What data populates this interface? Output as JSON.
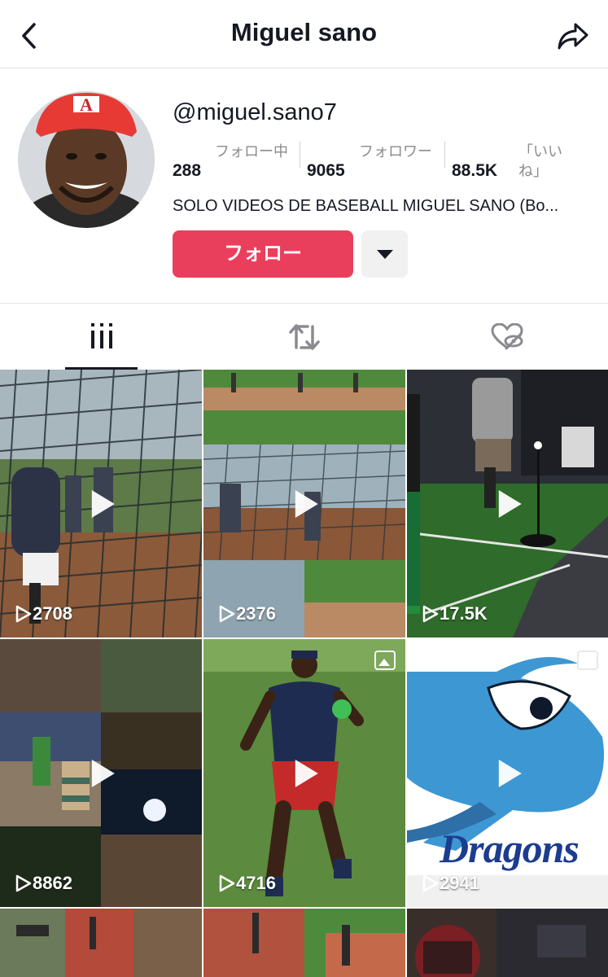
{
  "header": {
    "title": "Miguel sano",
    "back_icon": "chevron-left-icon",
    "share_icon": "share-icon"
  },
  "profile": {
    "handle": "@miguel.sano7",
    "stats": [
      {
        "value": "288",
        "label": "フォロー中"
      },
      {
        "value": "9065",
        "label": "フォロワー"
      },
      {
        "value": "88.5K",
        "label": "「いいね」"
      }
    ],
    "bio": "SOLO VIDEOS DE BASEBALL MIGUEL SANO (Bo...",
    "follow_label": "フォロー"
  },
  "tabs": [
    {
      "name": "videos",
      "icon": "grid-icon",
      "active": true
    },
    {
      "name": "reposts",
      "icon": "repost-icon",
      "active": false
    },
    {
      "name": "liked",
      "icon": "liked-hidden-icon",
      "active": false
    }
  ],
  "videos": [
    {
      "views": "2708",
      "theme": "cage"
    },
    {
      "views": "2376",
      "theme": "field"
    },
    {
      "views": "17.5K",
      "theme": "indoor"
    },
    {
      "views": "8862",
      "theme": "night"
    },
    {
      "views": "4716",
      "theme": "player",
      "photo": true
    },
    {
      "views": "2941",
      "theme": "dragons",
      "photo": true
    }
  ],
  "colors": {
    "accent": "#ea3f5c",
    "text": "#161823",
    "muted": "#8a8b91"
  }
}
